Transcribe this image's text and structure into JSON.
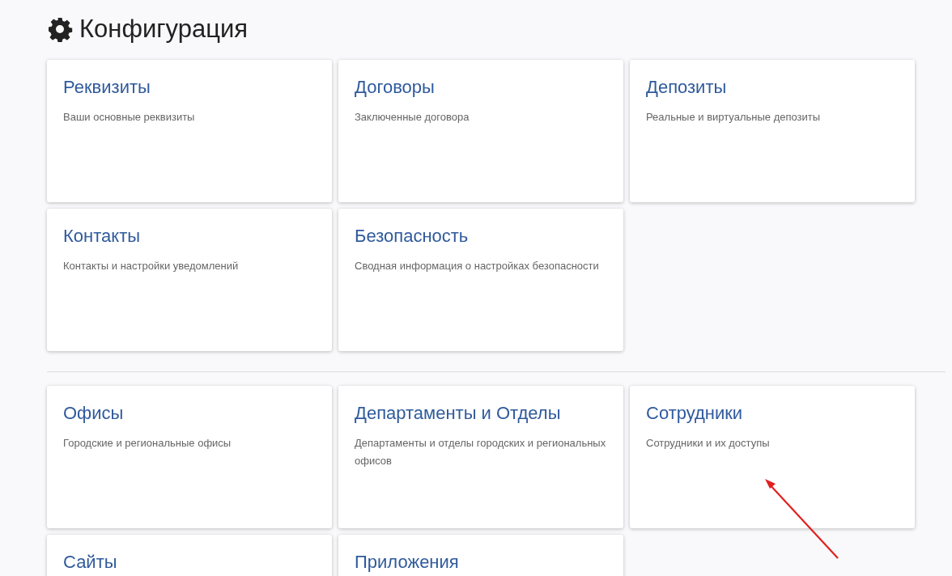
{
  "page": {
    "title": "Конфигурация"
  },
  "groups": [
    {
      "cards": [
        {
          "title": "Реквизиты",
          "description": "Ваши основные реквизиты"
        },
        {
          "title": "Договоры",
          "description": "Заключенные договора"
        },
        {
          "title": "Депозиты",
          "description": "Реальные и виртуальные депозиты"
        },
        {
          "title": "Контакты",
          "description": "Контакты и настройки уведомлений"
        },
        {
          "title": "Безопасность",
          "description": "Сводная информация о настройках безопасности"
        }
      ]
    },
    {
      "cards": [
        {
          "title": "Офисы",
          "description": "Городские и региональные офисы"
        },
        {
          "title": "Департаменты и Отделы",
          "description": "Департаменты и отделы городских и региональных офисов"
        },
        {
          "title": "Сотрудники",
          "description": "Сотрудники и их доступы"
        },
        {
          "title": "Сайты"
        },
        {
          "title": "Приложения"
        }
      ]
    }
  ]
}
